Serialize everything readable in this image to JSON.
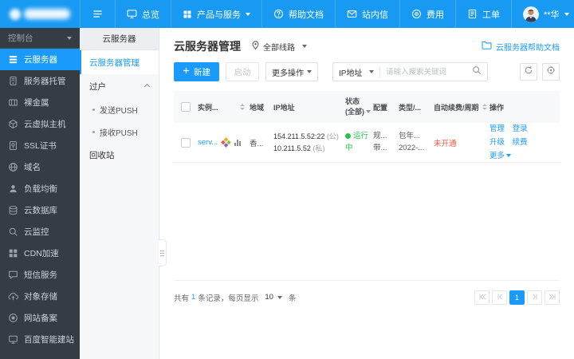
{
  "topbar": {
    "overview": "总览",
    "products": "产品与服务",
    "help_doc": "帮助文档",
    "messages": "站内信",
    "billing": "费用",
    "tickets": "工单",
    "username": "**华"
  },
  "sidebar": {
    "console": "控制台",
    "items": [
      "云服务器",
      "服务器托管",
      "裸金属",
      "云虚拟主机",
      "SSL证书",
      "域名",
      "负载均衡",
      "云数据库",
      "云监控",
      "CDN加速",
      "短信服务",
      "对象存储",
      "网站备案",
      "百度智能建站"
    ]
  },
  "subnav": {
    "title": "云服务器",
    "manage": "云服务器管理",
    "transfer": "过户",
    "send_push": "发送PUSH",
    "receive_push": "接收PUSH",
    "recycle": "回收站"
  },
  "main": {
    "title": "云服务器管理",
    "line_filter": "全部线路",
    "help_link": "云服务器帮助文档",
    "toolbar": {
      "create": "新建",
      "start": "启动",
      "more_ops": "更多操作",
      "search_type": "IP地址",
      "search_placeholder": "请输入搜索关键词"
    },
    "table": {
      "header": {
        "instance": "实例...",
        "region": "地域",
        "ip": "IP地址",
        "status": "状态",
        "status_filter": "(全部)",
        "config": "配置",
        "type": "类型/...",
        "renew": "自动续费/周期",
        "actions": "操作"
      },
      "row": {
        "name": "serv...",
        "region": "香...",
        "ip_public": "154.211.5.52:22",
        "ip_public_tag": "(公)",
        "ip_private": "10.211.5.52",
        "ip_private_tag": "(私)",
        "status": "运行中",
        "config_line1": "规...",
        "config_line2": "带...",
        "type_line1": "包年...",
        "type_line2": "2022-...",
        "renew": "未开通",
        "actions": {
          "manage": "管理",
          "login": "登录",
          "upgrade": "升级",
          "renew": "续费",
          "more": "更多"
        }
      }
    },
    "pagination": {
      "total_prefix": "共有",
      "total_count": "1",
      "total_mid": "条记录，每页显示",
      "page_size": "10",
      "total_suffix": "条",
      "page": "1"
    }
  },
  "colors": {
    "accent": "#1a9bfc",
    "topbar": "#189af2",
    "sidebar_bg": "#353c44",
    "status_green": "#27c24c",
    "alert_red": "#f0573d"
  },
  "icons": {
    "menu": "hamburger",
    "overview": "monitor",
    "products": "grid",
    "help": "question-circle",
    "messages": "envelope",
    "billing": "coin",
    "tickets": "document",
    "user": "avatar",
    "line": "location-pin",
    "help_link": "folder",
    "create": "plus",
    "search": "magnifier",
    "refresh": "circular-arrow",
    "settings": "gear",
    "sort": "dual-triangle",
    "status": "green-dot",
    "os": "pinwheel",
    "monitoring": "bar-chart",
    "pager": [
      "first",
      "prev",
      "next",
      "last"
    ]
  }
}
